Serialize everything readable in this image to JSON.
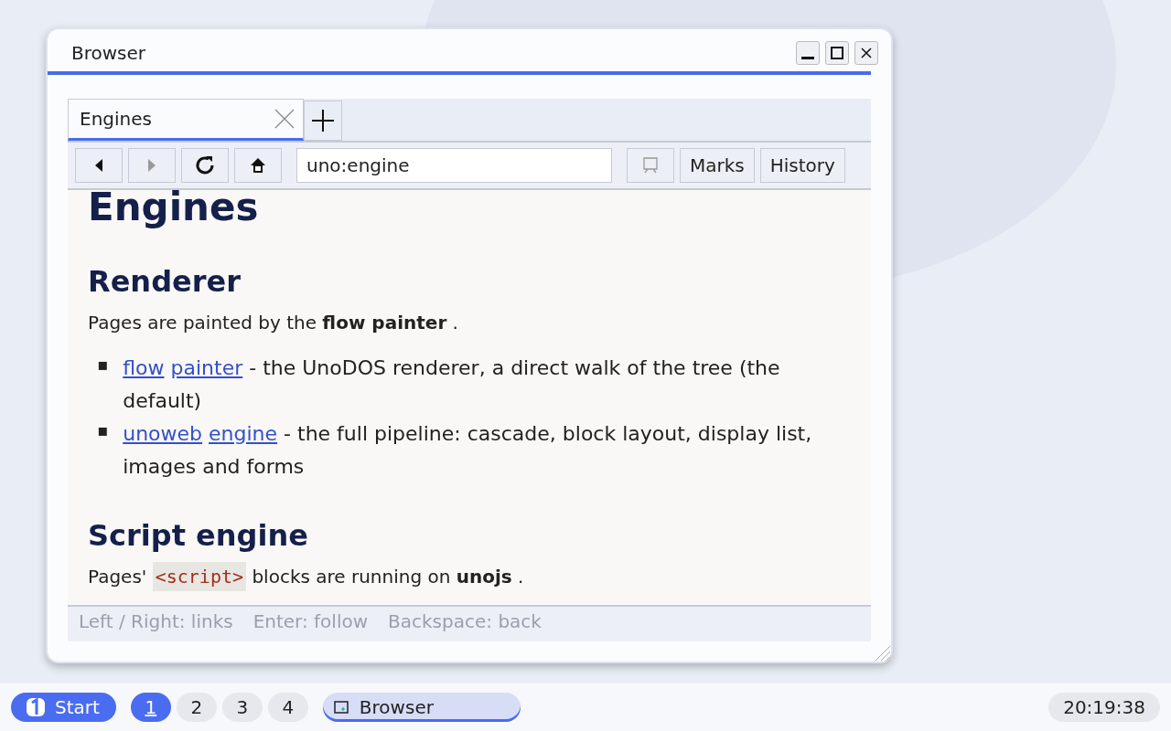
{
  "window": {
    "title": "Browser"
  },
  "tabs": [
    {
      "label": "Engines",
      "selected": true
    }
  ],
  "toolbar": {
    "address": "uno:engine",
    "buttons": [
      "Marks",
      "History"
    ]
  },
  "page": {
    "heading": "Engines",
    "sections": [
      {
        "heading": "Renderer",
        "paragraph": "Pages are painted by the **flow painter** .",
        "list": [
          {
            "marker": "▪",
            "links": [
              "flow",
              "painter"
            ],
            "text": "- the UnoDOS renderer, a direct walk of the tree (the default)"
          },
          {
            "marker": "▪",
            "links": [
              "unoweb",
              "engine"
            ],
            "text": "- the full pipeline: cascade, block layout, display list, images and forms"
          }
        ]
      },
      {
        "heading": "Script engine",
        "paragraph_parts": {
          "before": "Pages'",
          "code": "<script>",
          "after": "blocks are running on **unojs** ."
        }
      }
    ]
  },
  "status_bar": [
    "Left / Right: links",
    "Enter: follow",
    "Backspace: back"
  ],
  "taskbar": {
    "start": "Start",
    "workspaces": [
      {
        "label": "1",
        "selected": true
      },
      {
        "label": "2",
        "selected": false
      },
      {
        "label": "3",
        "selected": false
      },
      {
        "label": "4",
        "selected": false
      }
    ],
    "tasks": [
      {
        "label": "Browser",
        "selected": true
      }
    ],
    "clock": "20:19:38"
  }
}
